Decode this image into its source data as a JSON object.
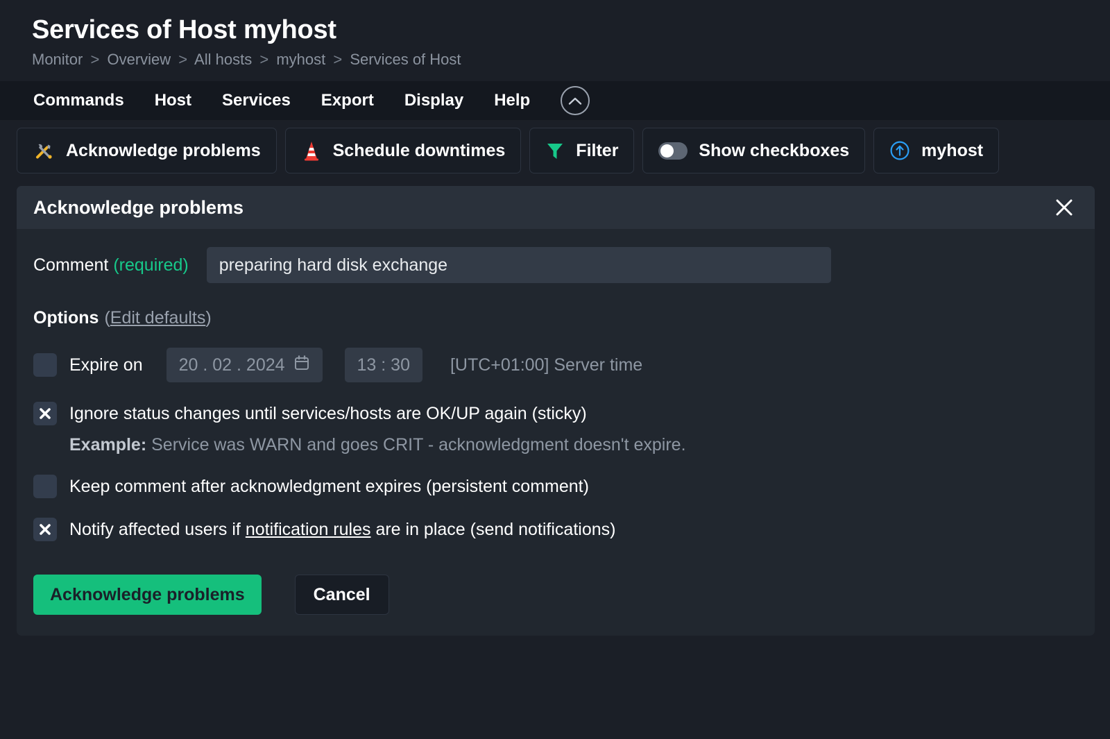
{
  "header": {
    "title": "Services of Host myhost",
    "breadcrumb": [
      "Monitor",
      "Overview",
      "All hosts",
      "myhost",
      "Services of Host"
    ],
    "breadcrumb_separator": ">"
  },
  "menu": {
    "items": [
      {
        "label": "Commands",
        "name": "menu-item-commands"
      },
      {
        "label": "Host",
        "name": "menu-item-host"
      },
      {
        "label": "Services",
        "name": "menu-item-services"
      },
      {
        "label": "Export",
        "name": "menu-item-export"
      },
      {
        "label": "Display",
        "name": "menu-item-display"
      },
      {
        "label": "Help",
        "name": "menu-item-help"
      }
    ],
    "collapse_icon": "chevron-up-icon"
  },
  "toolbar": {
    "acknowledge": {
      "label": "Acknowledge problems",
      "icon": "tools-icon"
    },
    "downtimes": {
      "label": "Schedule downtimes",
      "icon": "traffic-cone-icon"
    },
    "filter": {
      "label": "Filter",
      "icon": "funnel-icon"
    },
    "checkboxes": {
      "label": "Show checkboxes",
      "icon": "toggle-off-icon",
      "state": "off"
    },
    "host": {
      "label": "myhost",
      "icon": "circle-arrow-up-icon"
    }
  },
  "dialog": {
    "title": "Acknowledge problems",
    "close_icon": "close-icon",
    "comment": {
      "label": "Comment",
      "required_label": "(required)",
      "value": "preparing hard disk exchange",
      "placeholder": ""
    },
    "options": {
      "heading": "Options",
      "edit_defaults": "Edit defaults",
      "paren_open": "(",
      "paren_close": ")",
      "expire": {
        "label": "Expire on",
        "checked": false,
        "date": "20 . 02 . 2024",
        "date_icon": "calendar-icon",
        "time": "13 : 30",
        "timezone": "[UTC+01:00] Server time"
      },
      "sticky": {
        "checked": true,
        "text": "Ignore status changes until services/hosts are OK/UP again (sticky)",
        "example_strong": "Example:",
        "example_text": "Service was WARN and goes CRIT - acknowledgment doesn't expire."
      },
      "persistent": {
        "checked": false,
        "text": "Keep comment after acknowledgment expires (persistent comment)"
      },
      "notify": {
        "checked": true,
        "text_before": "Notify affected users if",
        "link": "notification rules",
        "text_after": "are in place (send notifications)"
      }
    },
    "submit_label": "Acknowledge problems",
    "cancel_label": "Cancel"
  },
  "colors": {
    "accent_green": "#15bf7c",
    "required_green": "#17c98a",
    "page_bg": "#1b1f27",
    "dialog_bg": "#21272f",
    "dialog_header_bg": "#2a313b"
  }
}
